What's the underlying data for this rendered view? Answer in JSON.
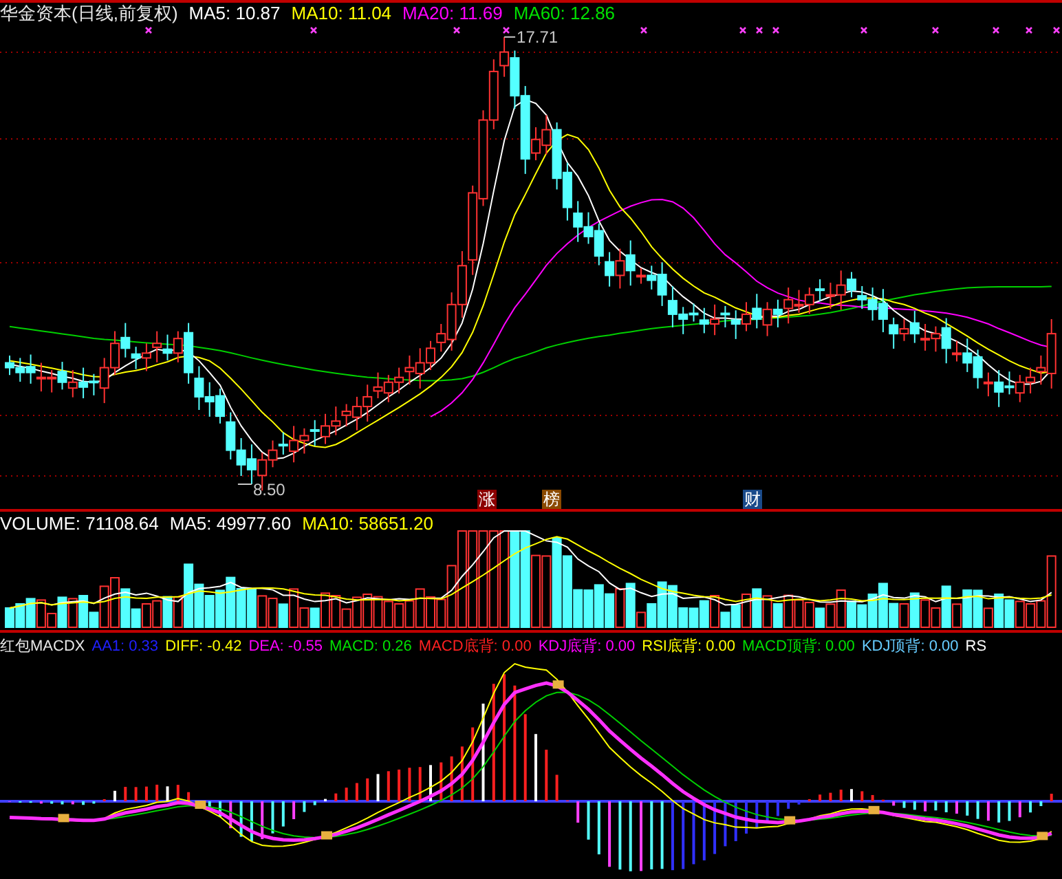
{
  "main_panel": {
    "title": "华金资本(日线,前复权)",
    "indicators": [
      {
        "label": "MA5: 10.87",
        "color": "#ffffff"
      },
      {
        "label": "MA10: 11.04",
        "color": "#ffff00"
      },
      {
        "label": "MA20: 11.69",
        "color": "#ff00ff"
      },
      {
        "label": "MA60: 12.86",
        "color": "#00e000"
      }
    ],
    "high_label": "17.71",
    "low_label": "8.50",
    "badges": [
      {
        "text": "涨",
        "color": "#8b0000"
      },
      {
        "text": "榜",
        "color": "#8b4a00"
      },
      {
        "text": "财",
        "color": "#1a4a8a"
      }
    ]
  },
  "volume_panel": {
    "indicators": [
      {
        "label": "VOLUME: 71108.64",
        "color": "#ffffff"
      },
      {
        "label": "MA5: 49977.60",
        "color": "#ffffff"
      },
      {
        "label": "MA10: 58651.20",
        "color": "#ffff00"
      }
    ]
  },
  "macd_panel": {
    "title": "红包MACDX",
    "indicators": [
      {
        "label": "AA1: 0.33",
        "color": "#2020ff"
      },
      {
        "label": "DIFF: -0.42",
        "color": "#ffff00"
      },
      {
        "label": "DEA: -0.55",
        "color": "#ff00ff"
      },
      {
        "label": "MACD: 0.26",
        "color": "#00e000"
      },
      {
        "label": "MACD底背: 0.00",
        "color": "#ff2020"
      },
      {
        "label": "KDJ底背: 0.00",
        "color": "#ff00ff"
      },
      {
        "label": "RSI底背: 0.00",
        "color": "#ffff00"
      },
      {
        "label": "MACD顶背: 0.00",
        "color": "#00e000"
      },
      {
        "label": "KDJ顶背: 0.00",
        "color": "#66ccff"
      },
      {
        "label": "RS",
        "color": "#ffffff"
      }
    ]
  }
}
